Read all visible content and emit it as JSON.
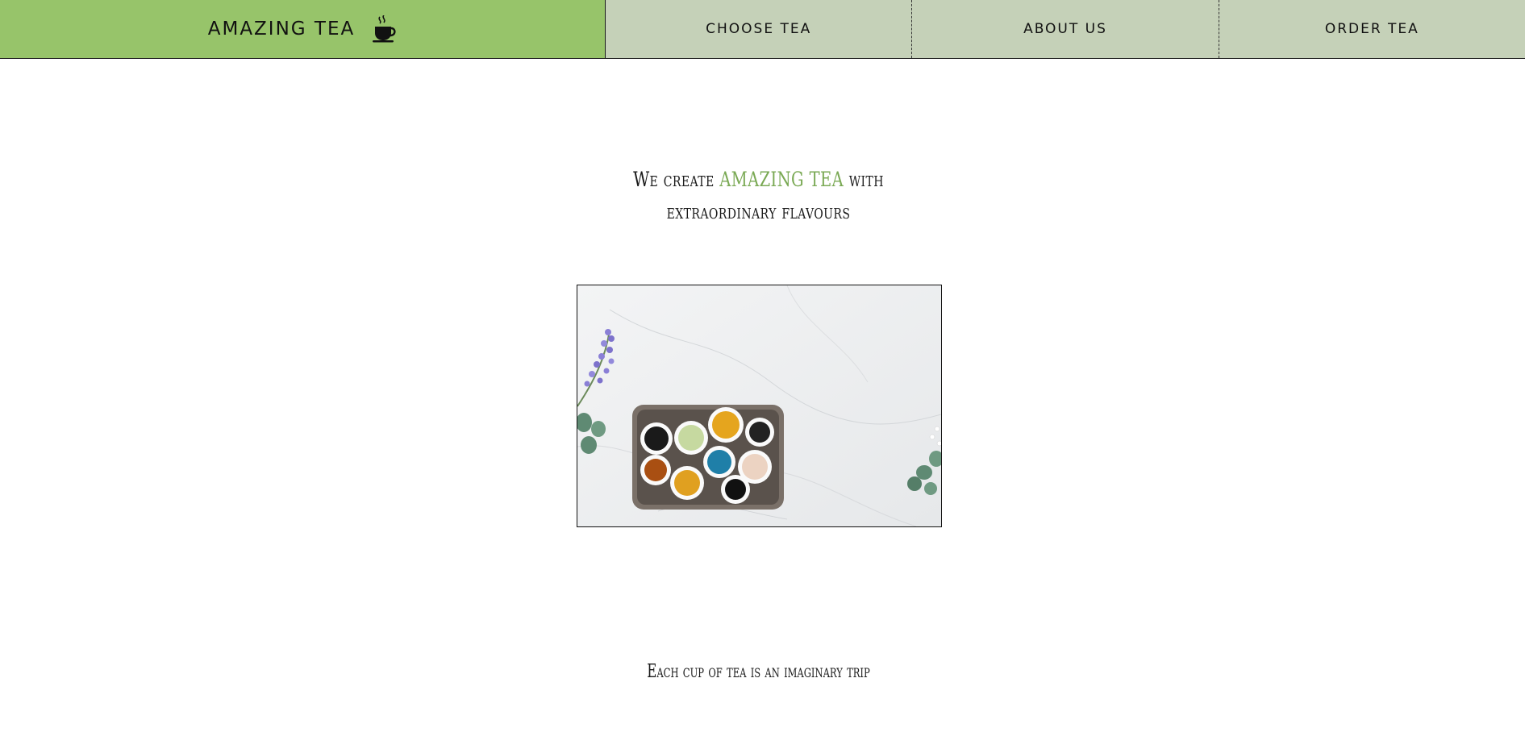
{
  "header": {
    "brand_title": "AMAZING TEA",
    "brand_icon": "tea-cup-icon",
    "brand_color": "#97c46a",
    "nav_color": "#c5d1b8",
    "nav": [
      {
        "label": "CHOOSE TEA"
      },
      {
        "label": "ABOUT US"
      },
      {
        "label": "ORDER TEA"
      }
    ]
  },
  "hero": {
    "tagline_prefix": "We create",
    "tagline_accent": "AMAZING TEA",
    "tagline_suffix": "with",
    "tagline_line2": "extraordinary flavours",
    "accent_color": "#7aa954"
  },
  "section": {
    "subline": "Each cup of tea is an imaginary trip"
  }
}
